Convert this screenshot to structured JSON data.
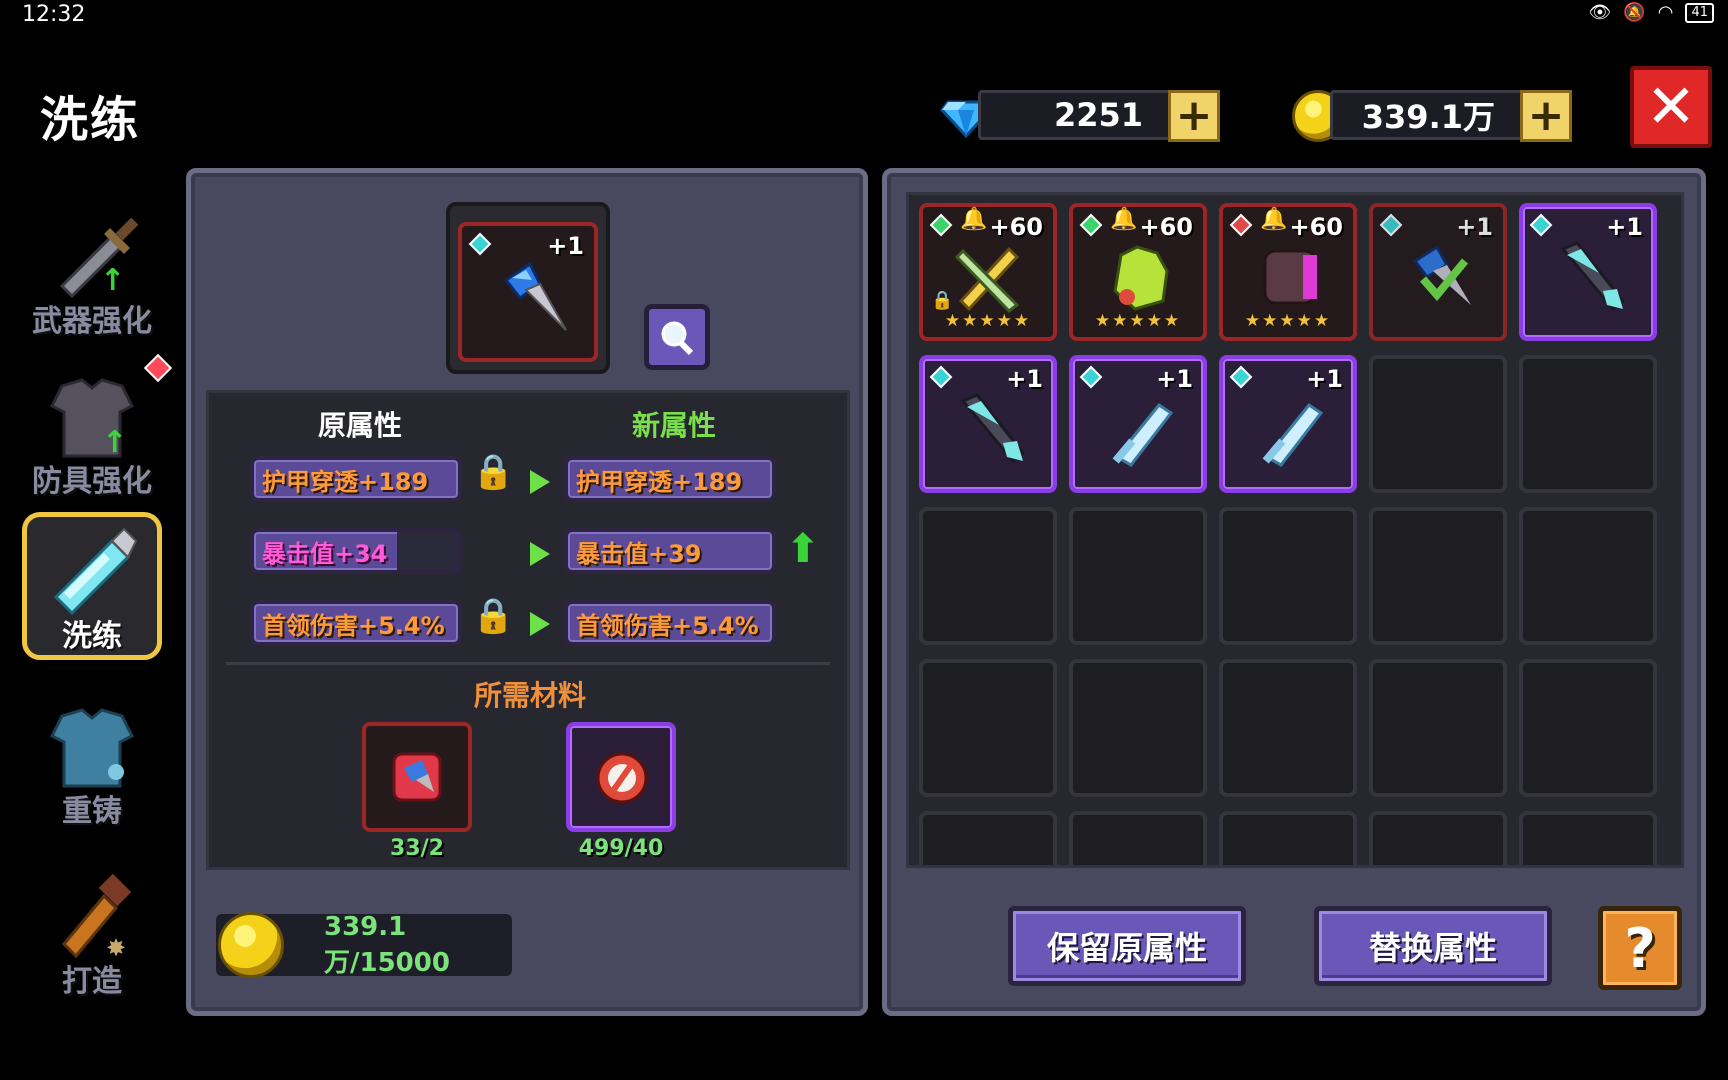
{
  "status_bar": {
    "time": "12:32",
    "battery": "41"
  },
  "page_title": "洗练",
  "currency": {
    "gems": "2251",
    "coins": "339.1万",
    "plus": "+"
  },
  "close_label": "✕",
  "nav": [
    {
      "label": "武器强化",
      "icon": "sword-icon",
      "active": false
    },
    {
      "label": "防具强化",
      "icon": "armor-icon",
      "active": false,
      "badge": true
    },
    {
      "label": "洗练",
      "icon": "refine-sword-icon",
      "active": true
    },
    {
      "label": "重铸",
      "icon": "recast-armor-icon",
      "active": false
    },
    {
      "label": "打造",
      "icon": "forge-hammer-icon",
      "active": false
    }
  ],
  "selected_item": {
    "plus": "+1",
    "icon": "drill-weapon-icon"
  },
  "attributes": {
    "original_header": "原属性",
    "new_header": "新属性",
    "rows": [
      {
        "original": "护甲穿透+189",
        "new": "护甲穿透+189",
        "locked": true,
        "improved": false,
        "color": "orange",
        "original_fill": 1.0
      },
      {
        "original": "暴击值+34",
        "new": "暴击值+39",
        "locked": false,
        "improved": true,
        "color": "magenta",
        "original_fill": 0.7
      },
      {
        "original": "首领伤害+5.4%",
        "new": "首领伤害+5.4%",
        "locked": true,
        "improved": false,
        "color": "orange",
        "original_fill": 1.0
      }
    ]
  },
  "materials": {
    "header": "所需材料",
    "items": [
      {
        "count": "33/2",
        "icon": "red-refine-stone-icon",
        "rarity": "red"
      },
      {
        "count": "499/40",
        "icon": "red-orb-icon",
        "rarity": "purple"
      }
    ]
  },
  "cost": "339.1万/15000",
  "inventory": [
    {
      "plus": "+60",
      "rarity": "red",
      "gem": "#3ad46a",
      "bell": true,
      "stars": "★★★★★",
      "locked": true,
      "icon": "golden-crossed-swords-icon"
    },
    {
      "plus": "+60",
      "rarity": "red",
      "gem": "#3ad46a",
      "bell": true,
      "stars": "★★★★★",
      "locked": false,
      "icon": "green-gauntlet-icon"
    },
    {
      "plus": "+60",
      "rarity": "red",
      "gem": "#e04a4a",
      "bell": true,
      "stars": "★★★★★",
      "locked": false,
      "icon": "purple-fist-icon"
    },
    {
      "plus": "+1",
      "rarity": "red",
      "gem": "#3ad4d4",
      "bell": false,
      "stars": "",
      "locked": false,
      "selected": true,
      "icon": "drill-weapon-icon"
    },
    {
      "plus": "+1",
      "rarity": "purple",
      "gem": "#3ad4d4",
      "bell": false,
      "stars": "",
      "locked": false,
      "icon": "dark-spear-icon"
    },
    {
      "plus": "+1",
      "rarity": "purple",
      "gem": "#3ad4d4",
      "bell": false,
      "stars": "",
      "locked": false,
      "icon": "dark-spear-icon"
    },
    {
      "plus": "+1",
      "rarity": "purple",
      "gem": "#3ad4d4",
      "bell": false,
      "stars": "",
      "locked": false,
      "icon": "ice-sword-icon"
    },
    {
      "plus": "+1",
      "rarity": "purple",
      "gem": "#3ad4d4",
      "bell": false,
      "stars": "",
      "locked": false,
      "icon": "ice-sword-icon"
    }
  ],
  "buttons": {
    "keep": "保留原属性",
    "replace": "替换属性",
    "help": "?"
  }
}
